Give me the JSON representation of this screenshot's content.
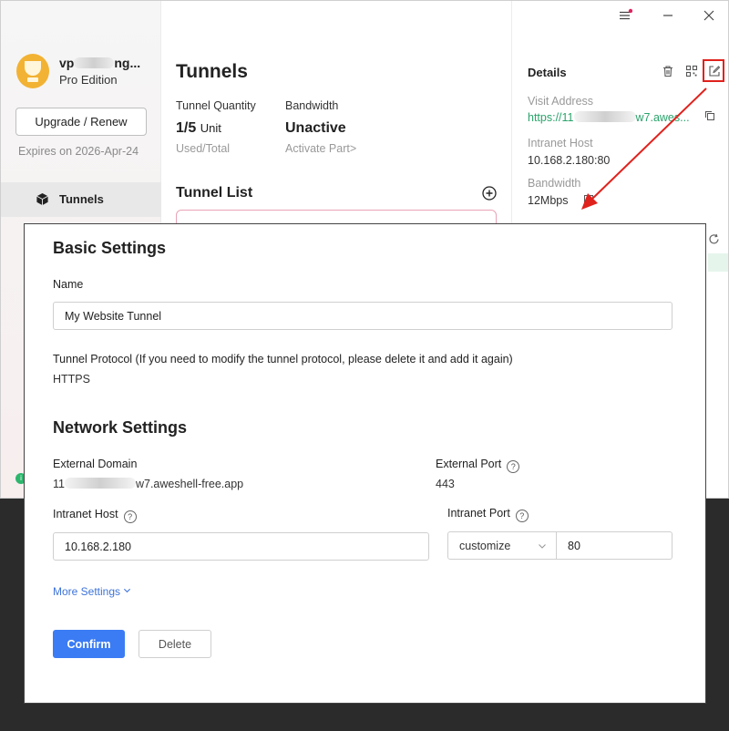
{
  "sidebar": {
    "user_name_start": "vp",
    "user_name_end": "ng...",
    "plan": "Pro Edition",
    "upgrade_label": "Upgrade / Renew",
    "expires": "Expires on 2026-Apr-24",
    "nav": [
      {
        "label": "Tunnels",
        "icon": "cube-icon",
        "active": true
      }
    ]
  },
  "main": {
    "title": "Tunnels",
    "quantity_label": "Tunnel Quantity",
    "quantity_value": "1/5",
    "quantity_unit": "Unit",
    "quantity_sub": "Used/Total",
    "bandwidth_label": "Bandwidth",
    "bandwidth_value": "Unactive",
    "bandwidth_sub": "Activate Part>",
    "list_title": "Tunnel List"
  },
  "details": {
    "title": "Details",
    "visit_label": "Visit Address",
    "visit_start": "https://11",
    "visit_end": "w7.awes...",
    "intranet_label": "Intranet Host",
    "intranet_value": "10.168.2.180:80",
    "bandwidth_label": "Bandwidth",
    "bandwidth_value": "12Mbps"
  },
  "modal": {
    "basic_title": "Basic Settings",
    "name_label": "Name",
    "name_value": "My Website Tunnel",
    "protocol_label": "Tunnel Protocol (If you need to modify the tunnel protocol, please delete it and add it again)",
    "protocol_value": "HTTPS",
    "network_title": "Network Settings",
    "ext_domain_label": "External Domain",
    "ext_domain_start": "11",
    "ext_domain_end": "w7.aweshell-free.app",
    "ext_port_label": "External Port",
    "ext_port_value": "443",
    "intranet_host_label": "Intranet Host",
    "intranet_host_value": "10.168.2.180",
    "intranet_port_label": "Intranet Port",
    "port_mode": "customize",
    "port_value": "80",
    "more_settings": "More Settings",
    "confirm_label": "Confirm",
    "delete_label": "Delete"
  },
  "colors": {
    "accent": "#3b7cf4",
    "link_green": "#2aa36b",
    "highlight_red": "#e0221d"
  }
}
